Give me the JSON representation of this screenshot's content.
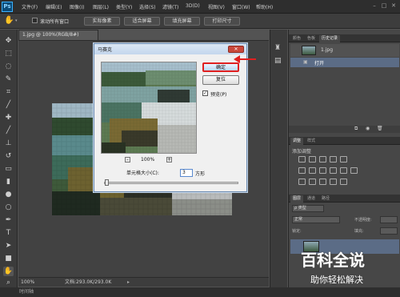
{
  "app": {
    "logo": "Ps",
    "menu": [
      "文件(F)",
      "编辑(E)",
      "图像(I)",
      "图层(L)",
      "类型(Y)",
      "选择(S)",
      "滤镜(T)",
      "3D(D)",
      "视图(V)",
      "窗口(W)",
      "帮助(H)"
    ]
  },
  "options_bar": {
    "scroll_all_label": "滚动所有窗口",
    "buttons": [
      "实际像素",
      "适合屏幕",
      "填充屏幕",
      "打印尺寸"
    ]
  },
  "document": {
    "tab_title": "1.jpg @ 100%(RGB/8#)",
    "zoom": "100%",
    "doc_info": "文档:293.0K/293.0K"
  },
  "timeline": {
    "label": "时间轴"
  },
  "panels": {
    "top_tabs": [
      "颜色",
      "色板",
      "历史记录"
    ],
    "history_items": [
      "1.jpg",
      "打开"
    ],
    "adjust_tabs": [
      "调整",
      "样式"
    ],
    "adjust_title": "添加调整",
    "layer_tabs": [
      "图层",
      "通道",
      "路径"
    ],
    "layer_kind": "ρ 类型",
    "blend_mode": "正常",
    "opacity_label": "不透明度:",
    "lock_label": "锁定:",
    "fill_label": "填充:"
  },
  "dialog": {
    "title": "马赛克",
    "ok_label": "确定",
    "reset_label": "复位",
    "preview_label": "预览(P)",
    "zoom_value": "100%",
    "zoom_minus": "-",
    "zoom_plus": "+",
    "cell_size_label": "单元格大小(C):",
    "cell_size_value": "3",
    "cell_size_unit": "方形"
  },
  "watermark": {
    "title": "百科全说",
    "subtitle": "助你轻松解决"
  }
}
